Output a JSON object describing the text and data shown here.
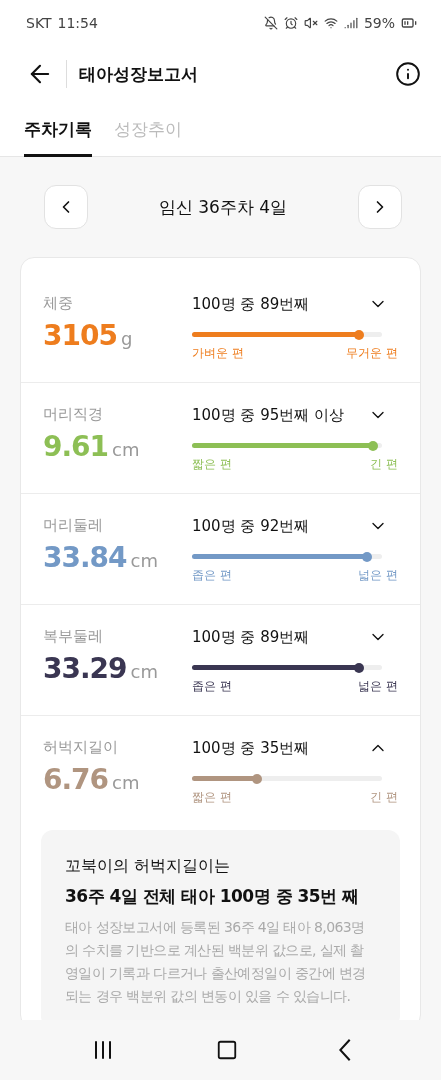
{
  "status_bar": {
    "carrier": "SKT",
    "time": "11:54",
    "battery": "59%"
  },
  "header": {
    "title": "태아성장보고서"
  },
  "tabs": [
    {
      "label": "주차기록",
      "selected": true
    },
    {
      "label": "성장추이",
      "selected": false
    }
  ],
  "week_nav": {
    "label": "임신 36주차 4일"
  },
  "measurements": [
    {
      "name": "체중",
      "value": "3105",
      "unit": "g",
      "rank": "100명 중 89번째",
      "level": 0.88,
      "low_label": "가벼운 편",
      "high_label": "무거운 편",
      "color": "#ee7d1e",
      "expanded": false
    },
    {
      "name": "머리직경",
      "value": "9.61",
      "unit": "cm",
      "rank": "100명 중 95번째 이상",
      "level": 0.95,
      "low_label": "짧은 편",
      "high_label": "긴 편",
      "color": "#8dbf55",
      "expanded": false
    },
    {
      "name": "머리둘레",
      "value": "33.84",
      "unit": "cm",
      "rank": "100명 중 92번째",
      "level": 0.92,
      "low_label": "좁은 편",
      "high_label": "넓은 편",
      "color": "#7399c6",
      "expanded": false
    },
    {
      "name": "복부둘레",
      "value": "33.29",
      "unit": "cm",
      "rank": "100명 중 89번째",
      "level": 0.88,
      "low_label": "좁은 편",
      "high_label": "넓은 편",
      "color": "#3a3652",
      "expanded": false
    },
    {
      "name": "허벅지길이",
      "value": "6.76",
      "unit": "cm",
      "rank": "100명 중 35번째",
      "level": 0.34,
      "low_label": "짧은 편",
      "high_label": "긴 편",
      "color": "#b09580",
      "expanded": true
    }
  ],
  "detail": {
    "intro": "꼬북이의 허벅지길이는",
    "headline": "36주 4일 전체 태아 100명 중 35번 째",
    "note": "태아 성장보고서에 등록된 36주 4일 태아 8,063명의 수치를 기반으로 계산된 백분위 값으로, 실제 촬영일이 기록과 다르거나 출산예정일이 중간에 변경되는 경우 백분위 값의 변동이 있을 수 있습니다."
  }
}
